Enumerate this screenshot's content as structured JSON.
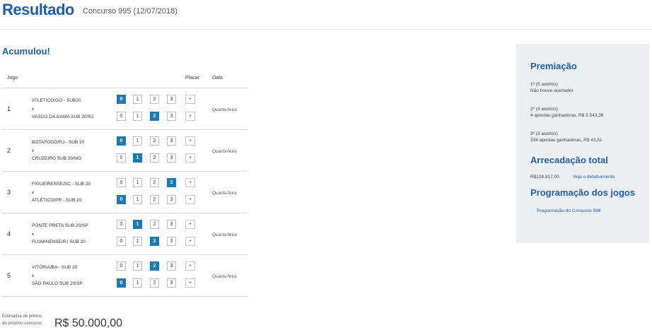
{
  "header": {
    "title": "Resultado",
    "subtitle": "Concurso 995 (12/07/2018)"
  },
  "status": "Acumulou!",
  "table": {
    "col_jogo": "Jogo",
    "col_placar": "Placar",
    "col_data": "Data",
    "vs": "x",
    "plus": "+",
    "score_options": [
      "0",
      "1",
      "2",
      "3"
    ],
    "games": [
      {
        "num": "1",
        "home": "ATLETICO/GO - SUB20",
        "away": "VASCO DA GAMA SUB 20/RJ",
        "home_score": 0,
        "away_score": 2,
        "day": "Quarta-feira"
      },
      {
        "num": "2",
        "home": "BOTAFOGO/RJ - SUB 20",
        "away": "CRUZEIRO SUB 20/MG",
        "home_score": 0,
        "away_score": 1,
        "day": "Quarta-feira"
      },
      {
        "num": "3",
        "home": "FIGUEIRENSE/SC - SUB 20",
        "away": "ATLÉTICO/PR - SUB 20",
        "home_score": 3,
        "away_score": 0,
        "day": "Quarta-feira"
      },
      {
        "num": "4",
        "home": "PONTE PRETA SUB 20/SP",
        "away": "FLUMINENSE/RJ SUB 20",
        "home_score": 1,
        "away_score": 2,
        "day": "Quarta-feira"
      },
      {
        "num": "5",
        "home": "VITÓRIA/BA - SUB 20",
        "away": "SÃO PAULO SUB 20/SP",
        "home_score": 2,
        "away_score": 0,
        "day": "Quarta-feira"
      }
    ]
  },
  "estimate": {
    "label_line1": "Estimativa de prêmio",
    "label_line2": "do próximo concurso",
    "value": "R$ 50.000,00"
  },
  "sidebar": {
    "premiacao_title": "Premiação",
    "prizes": [
      {
        "tier": "1º (5 acertos)",
        "detail": "Não houve acertador"
      },
      {
        "tier": "2º (4 acertos)",
        "detail": "4 apostas ganhadoras, R$ 2.543,36"
      },
      {
        "tier": "3º (3 acertos)",
        "detail": "334 apostas ganhadoras, R$ 43,51"
      }
    ],
    "arrecadacao_title": "Arrecadação total",
    "arrecadacao_value": "R$128.817,00",
    "arrecadacao_link": "Veja o detalhamento",
    "programacao_title": "Programação dos jogos",
    "programacao_link": "Programação do Concurso 996"
  }
}
